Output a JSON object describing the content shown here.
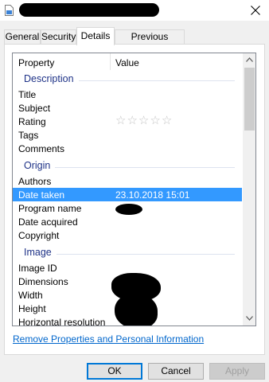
{
  "window": {
    "title": "",
    "close_icon": "close-icon",
    "file_icon": "file-icon"
  },
  "tabs": [
    {
      "label": "General"
    },
    {
      "label": "Security"
    },
    {
      "label": "Details"
    },
    {
      "label": "Previous Versions"
    }
  ],
  "table": {
    "col_property": "Property",
    "col_value": "Value"
  },
  "groups": {
    "description": "Description",
    "origin": "Origin",
    "image": "Image"
  },
  "rows": {
    "title": "Title",
    "subject": "Subject",
    "rating": "Rating",
    "tags": "Tags",
    "comments": "Comments",
    "authors": "Authors",
    "date_taken": "Date taken",
    "date_taken_value": "23.10.2018 15:01",
    "program_name": "Program name",
    "date_acquired": "Date acquired",
    "copyright": "Copyright",
    "image_id": "Image ID",
    "dimensions": "Dimensions",
    "width": "Width",
    "height": "Height",
    "horizontal_resolution": "Horizontal resolution"
  },
  "rating": {
    "stars_filled": 0,
    "stars_total": 5
  },
  "links": {
    "remove_properties": "Remove Properties and Personal Information"
  },
  "buttons": {
    "ok": "OK",
    "cancel": "Cancel",
    "apply": "Apply"
  },
  "colors": {
    "selection": "#3399ff",
    "group_header": "#1e3287",
    "link": "#0066cc",
    "redaction": "#000000"
  }
}
